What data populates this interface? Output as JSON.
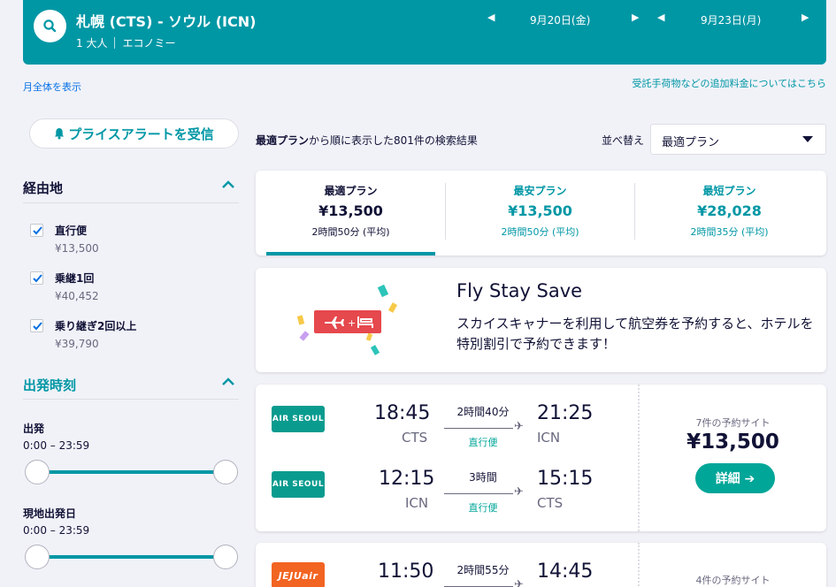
{
  "search": {
    "route": "札幌 (CTS) - ソウル (ICN)",
    "passengers": "1 大人",
    "cabin": "エコノミー",
    "depart_date": "9月20日(金)",
    "return_date": "9月23日(月)"
  },
  "links": {
    "show_month": "月全体を表示",
    "baggage_fees": "受託手荷物などの追加料金についてはこちら"
  },
  "price_alert": {
    "label": "プライスアラートを受信"
  },
  "filters": {
    "stops_title": "経由地",
    "stops": [
      {
        "label": "直行便",
        "price": "¥13,500",
        "checked": true
      },
      {
        "label": "乗継1回",
        "price": "¥40,452",
        "checked": true
      },
      {
        "label": "乗り継ぎ2回以上",
        "price": "¥39,790",
        "checked": true
      }
    ],
    "depart_time_title": "出発時刻",
    "outbound_label": "出発",
    "outbound_range": "0:00 – 23:59",
    "return_label": "現地出発日",
    "return_range": "0:00 – 23:59"
  },
  "results": {
    "summary_bold": "最適プラン",
    "summary_rest": "から順に表示した801件の検索結果",
    "sort_label": "並べ替え",
    "sort_value": "最適プラン"
  },
  "tabs": [
    {
      "label": "最適プラン",
      "price": "¥13,500",
      "duration": "2時間50分 (平均)"
    },
    {
      "label": "最安プラン",
      "price": "¥13,500",
      "duration": "2時間50分 (平均)"
    },
    {
      "label": "最短プラン",
      "price": "¥28,028",
      "duration": "2時間35分 (平均)"
    }
  ],
  "promo": {
    "title": "Fly Stay Save",
    "body": "スカイスキャナーを利用して航空券を予約すると、ホテルを特別割引で予約できます！"
  },
  "flights": [
    {
      "legs": [
        {
          "airline": "AIR SEOUL",
          "dep_time": "18:45",
          "dep_code": "CTS",
          "duration": "2時間40分",
          "stops": "直行便",
          "arr_time": "21:25",
          "arr_code": "ICN"
        },
        {
          "airline": "AIR SEOUL",
          "dep_time": "12:15",
          "dep_code": "ICN",
          "duration": "3時間",
          "stops": "直行便",
          "arr_time": "15:15",
          "arr_code": "CTS"
        }
      ],
      "sites": "7件の予約サイト",
      "price": "¥13,500",
      "detail_label": "詳細 ➔"
    },
    {
      "legs": [
        {
          "airline": "JEJUair",
          "dep_time": "11:50",
          "duration": "2時間55分",
          "arr_time": "14:45"
        }
      ],
      "sites": "4件の予約サイト"
    }
  ],
  "colors": {
    "accent": "#0097a5",
    "green": "#00a698",
    "link": "#0770e3"
  }
}
